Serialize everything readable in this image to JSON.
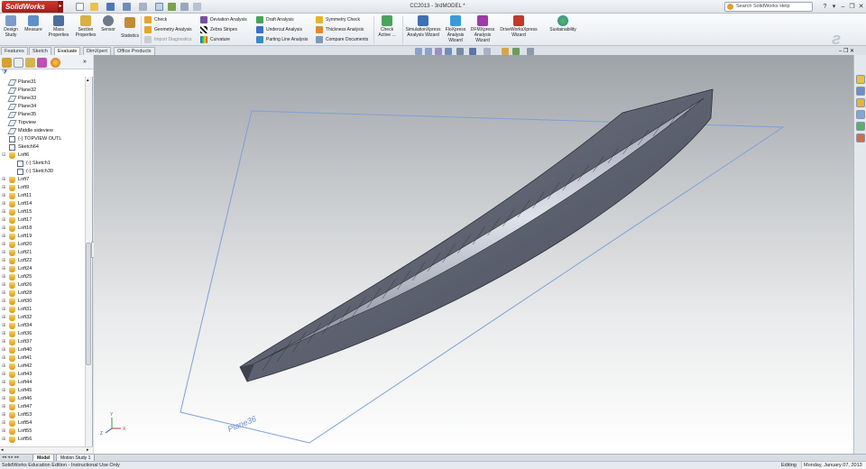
{
  "titlebar": {
    "app_name": "SolidWorks",
    "doc_title": "CC2013 - 3rdMODEL *",
    "search_placeholder": "Search SolidWorks Help"
  },
  "ribbon": {
    "big_buttons": [
      {
        "label": "Design Study",
        "icon": "design-study-icon"
      },
      {
        "label": "Measure",
        "icon": "measure-icon"
      },
      {
        "label": "Mass Properties",
        "icon": "mass-properties-icon"
      },
      {
        "label": "Section Properties",
        "icon": "section-properties-icon"
      },
      {
        "label": "Sensor",
        "icon": "sensor-icon"
      },
      {
        "label": "Statistics",
        "icon": "statistics-icon"
      }
    ],
    "col1": [
      "Check",
      "Geometry Analysis",
      "Import Diagnostics"
    ],
    "col2": [
      "Deviation Analysis",
      "Zebra Stripes",
      "Curvature"
    ],
    "col3": [
      "Draft Analysis",
      "Undercut Analysis",
      "Parting Line Analysis"
    ],
    "col4": [
      "Symmetry Check",
      "Thickness Analysis",
      "Compare Documents"
    ],
    "check_active": "Check Active ...",
    "wizards": [
      {
        "label": "SimulationXpress Analysis Wizard"
      },
      {
        "label": "FloXpress Analysis Wizard"
      },
      {
        "label": "DFMXpress Analysis Wizard"
      },
      {
        "label": "DriveWorksXpress Wizard"
      },
      {
        "label": "Sustainability"
      }
    ]
  },
  "tabs": [
    "Features",
    "Sketch",
    "Evaluate",
    "DimXpert",
    "Office Products"
  ],
  "active_tab": "Evaluate",
  "tree": [
    {
      "label": "Plane31",
      "type": "plane",
      "indent": 0
    },
    {
      "label": "Plane32",
      "type": "plane",
      "indent": 0
    },
    {
      "label": "Plane33",
      "type": "plane",
      "indent": 0
    },
    {
      "label": "Plane34",
      "type": "plane",
      "indent": 0
    },
    {
      "label": "Plane35",
      "type": "plane",
      "indent": 0
    },
    {
      "label": "Topview",
      "type": "plane",
      "indent": 0
    },
    {
      "label": "Middle sideview",
      "type": "plane",
      "indent": 0
    },
    {
      "label": "(-) TOPVIEW OUTL",
      "type": "sketch",
      "indent": 0
    },
    {
      "label": "Sketch64",
      "type": "sketch",
      "indent": 0
    },
    {
      "label": "Loft6",
      "type": "loft",
      "indent": 0,
      "expanded": true
    },
    {
      "label": "(-) Sketch1",
      "type": "sketch",
      "indent": 1
    },
    {
      "label": "(-) Sketch30",
      "type": "sketch",
      "indent": 1
    },
    {
      "label": "Loft7",
      "type": "loft",
      "indent": 0
    },
    {
      "label": "Loft9",
      "type": "loft",
      "indent": 0
    },
    {
      "label": "Loft11",
      "type": "loft",
      "indent": 0
    },
    {
      "label": "Loft14",
      "type": "loft",
      "indent": 0
    },
    {
      "label": "Loft15",
      "type": "loft",
      "indent": 0
    },
    {
      "label": "Loft17",
      "type": "loft",
      "indent": 0
    },
    {
      "label": "Loft18",
      "type": "loft",
      "indent": 0
    },
    {
      "label": "Loft19",
      "type": "loft",
      "indent": 0
    },
    {
      "label": "Loft20",
      "type": "loft",
      "indent": 0
    },
    {
      "label": "Loft21",
      "type": "loft",
      "indent": 0
    },
    {
      "label": "Loft22",
      "type": "loft",
      "indent": 0
    },
    {
      "label": "Loft24",
      "type": "loft",
      "indent": 0
    },
    {
      "label": "Loft25",
      "type": "loft",
      "indent": 0
    },
    {
      "label": "Loft26",
      "type": "loft",
      "indent": 0
    },
    {
      "label": "Loft28",
      "type": "loft",
      "indent": 0
    },
    {
      "label": "Loft30",
      "type": "loft",
      "indent": 0
    },
    {
      "label": "Loft31",
      "type": "loft",
      "indent": 0
    },
    {
      "label": "Loft32",
      "type": "loft",
      "indent": 0
    },
    {
      "label": "Loft34",
      "type": "loft",
      "indent": 0
    },
    {
      "label": "Loft36",
      "type": "loft",
      "indent": 0
    },
    {
      "label": "Loft37",
      "type": "loft",
      "indent": 0
    },
    {
      "label": "Loft40",
      "type": "loft",
      "indent": 0
    },
    {
      "label": "Loft41",
      "type": "loft",
      "indent": 0
    },
    {
      "label": "Loft42",
      "type": "loft",
      "indent": 0
    },
    {
      "label": "Loft43",
      "type": "loft",
      "indent": 0
    },
    {
      "label": "Loft44",
      "type": "loft",
      "indent": 0
    },
    {
      "label": "Loft45",
      "type": "loft",
      "indent": 0
    },
    {
      "label": "Loft46",
      "type": "loft",
      "indent": 0
    },
    {
      "label": "Loft47",
      "type": "loft",
      "indent": 0
    },
    {
      "label": "Loft53",
      "type": "loft",
      "indent": 0
    },
    {
      "label": "Loft54",
      "type": "loft",
      "indent": 0
    },
    {
      "label": "Loft55",
      "type": "loft",
      "indent": 0
    },
    {
      "label": "Loft56",
      "type": "loft",
      "indent": 0
    }
  ],
  "viewport": {
    "plane_label": "Plane36",
    "triad": {
      "x": "X",
      "y": "Y",
      "z": "Z"
    }
  },
  "bottom_tabs": [
    "Model",
    "Motion Study 1"
  ],
  "status": {
    "left": "SolidWorks Education Edition - Instructional Use Only",
    "mode": "Editing",
    "date": "Monday, January 07, 2013"
  },
  "colors": {
    "logo_red": "#c0392b",
    "hull": "#6a6f7c",
    "plane_outline": "#7da0d8"
  }
}
